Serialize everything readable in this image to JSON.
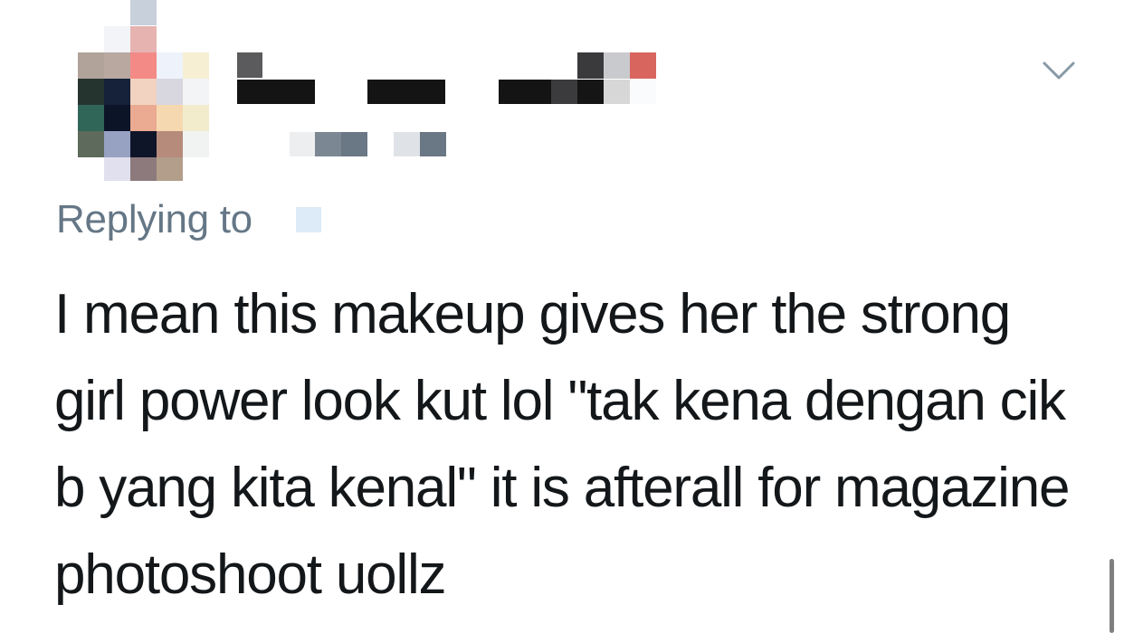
{
  "tweet": {
    "reply_label": "Replying to",
    "text": "I mean this makeup gives her the strong girl power look kut lol \"tak kena dengan cik b yang kita kenal\" it is afterall for magazine photoshoot uollz"
  },
  "icons": {
    "menu": "chevron-down-icon"
  },
  "colors": {
    "text": "#14171a",
    "secondary": "#657786",
    "background": "#ffffff"
  }
}
